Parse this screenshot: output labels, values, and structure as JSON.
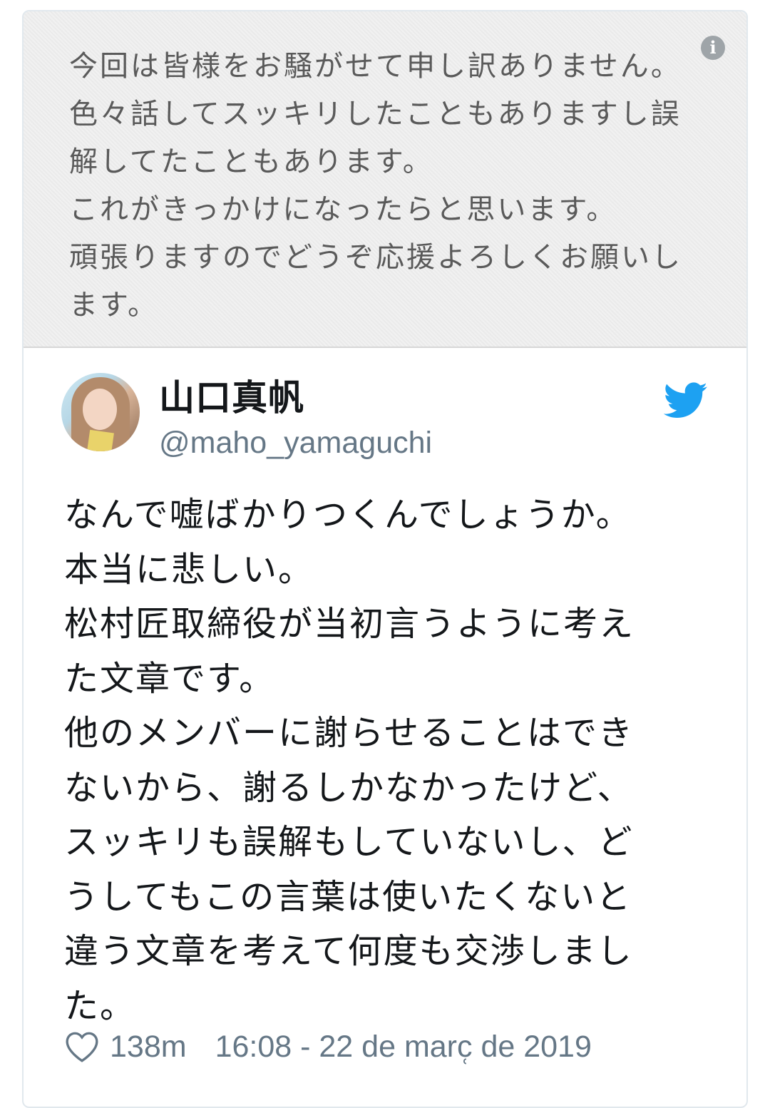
{
  "quoted_card": {
    "lines": [
      "今回は皆様をお騒がせて申し訳ありません。",
      "色々話してスッキリしたこともありますし誤",
      "解してたこともあります。",
      "これがきっかけになったらと思います。",
      "頑張りますのでどうぞ応援よろしくお願いし",
      "ます。"
    ],
    "info_icon_glyph": "i"
  },
  "tweet": {
    "display_name": "山口真帆",
    "handle": "@maho_yamaguchi",
    "lines": [
      "なんで嘘ばかりつくんでしょうか。",
      "本当に悲しい。",
      "松村匠取締役が当初言うように考え",
      "た文章です。",
      "他のメンバーに謝らせることはでき",
      "ないから、謝るしかなかったけど、",
      "スッキリも誤解もしていないし、ど",
      "うしてもこの言葉は使いたくないと",
      "違う文章を考えて何度も交渉しまし",
      "た。"
    ],
    "likes": "138m",
    "timestamp": "16:08 - 22 de marc̜ de 2019"
  },
  "colors": {
    "twitter_blue": "#1da1f2",
    "secondary_text": "#657786",
    "primary_text": "#14171a",
    "quoted_background": "#eeeeee"
  },
  "icons": [
    "info-icon",
    "avatar",
    "twitter-bird-icon",
    "heart-icon"
  ]
}
